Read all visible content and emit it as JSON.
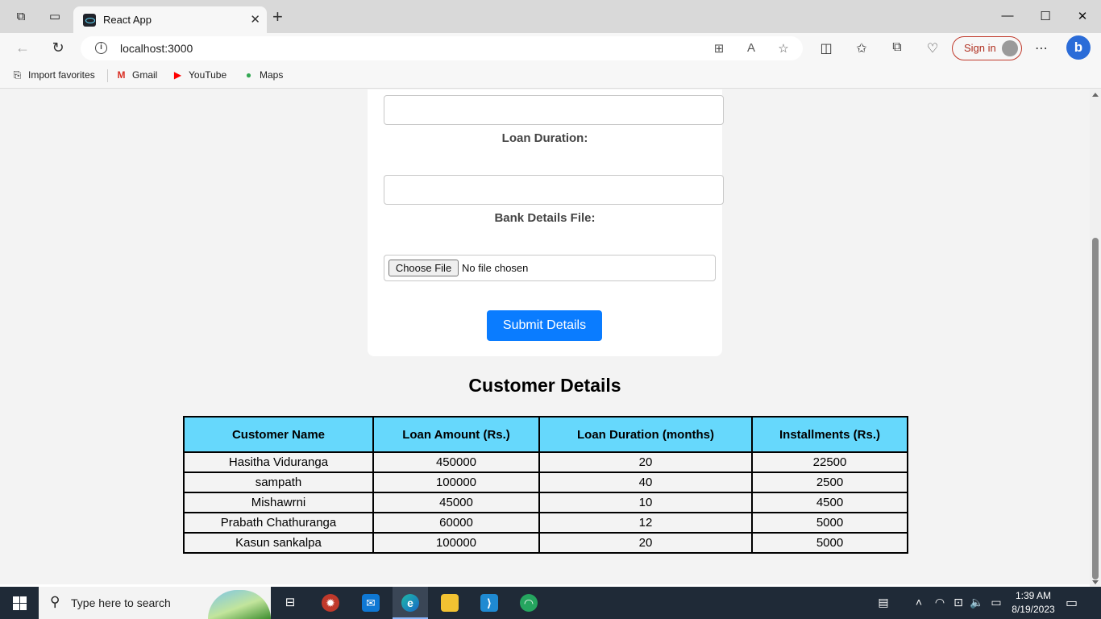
{
  "browser": {
    "tab_title": "React App",
    "url": "localhost:3000",
    "sign_in_label": "Sign in",
    "favorites": [
      {
        "label": "Import favorites",
        "icon": "import-favorites-icon"
      },
      {
        "label": "Gmail",
        "icon": "gmail-icon"
      },
      {
        "label": "YouTube",
        "icon": "youtube-icon"
      },
      {
        "label": "Maps",
        "icon": "maps-icon"
      }
    ]
  },
  "form": {
    "loan_duration_label": "Loan Duration:",
    "bank_details_label": "Bank Details File:",
    "choose_file_label": "Choose File",
    "no_file_text": "No file chosen",
    "submit_label": "Submit Details"
  },
  "customers": {
    "title": "Customer Details",
    "headers": [
      "Customer Name",
      "Loan Amount (Rs.)",
      "Loan Duration (months)",
      "Installments (Rs.)"
    ],
    "rows": [
      [
        "Hasitha Viduranga",
        "450000",
        "20",
        "22500"
      ],
      [
        "sampath",
        "100000",
        "40",
        "2500"
      ],
      [
        "Mishawrni",
        "45000",
        "10",
        "4500"
      ],
      [
        "Prabath Chathuranga",
        "60000",
        "12",
        "5000"
      ],
      [
        "Kasun sankalpa",
        "100000",
        "20",
        "5000"
      ]
    ]
  },
  "taskbar": {
    "search_placeholder": "Type here to search",
    "time": "1:39 AM",
    "date": "8/19/2023"
  },
  "colors": {
    "accent_button": "#0a7cff",
    "table_header": "#66d8fc",
    "taskbar": "#1f2a37"
  }
}
